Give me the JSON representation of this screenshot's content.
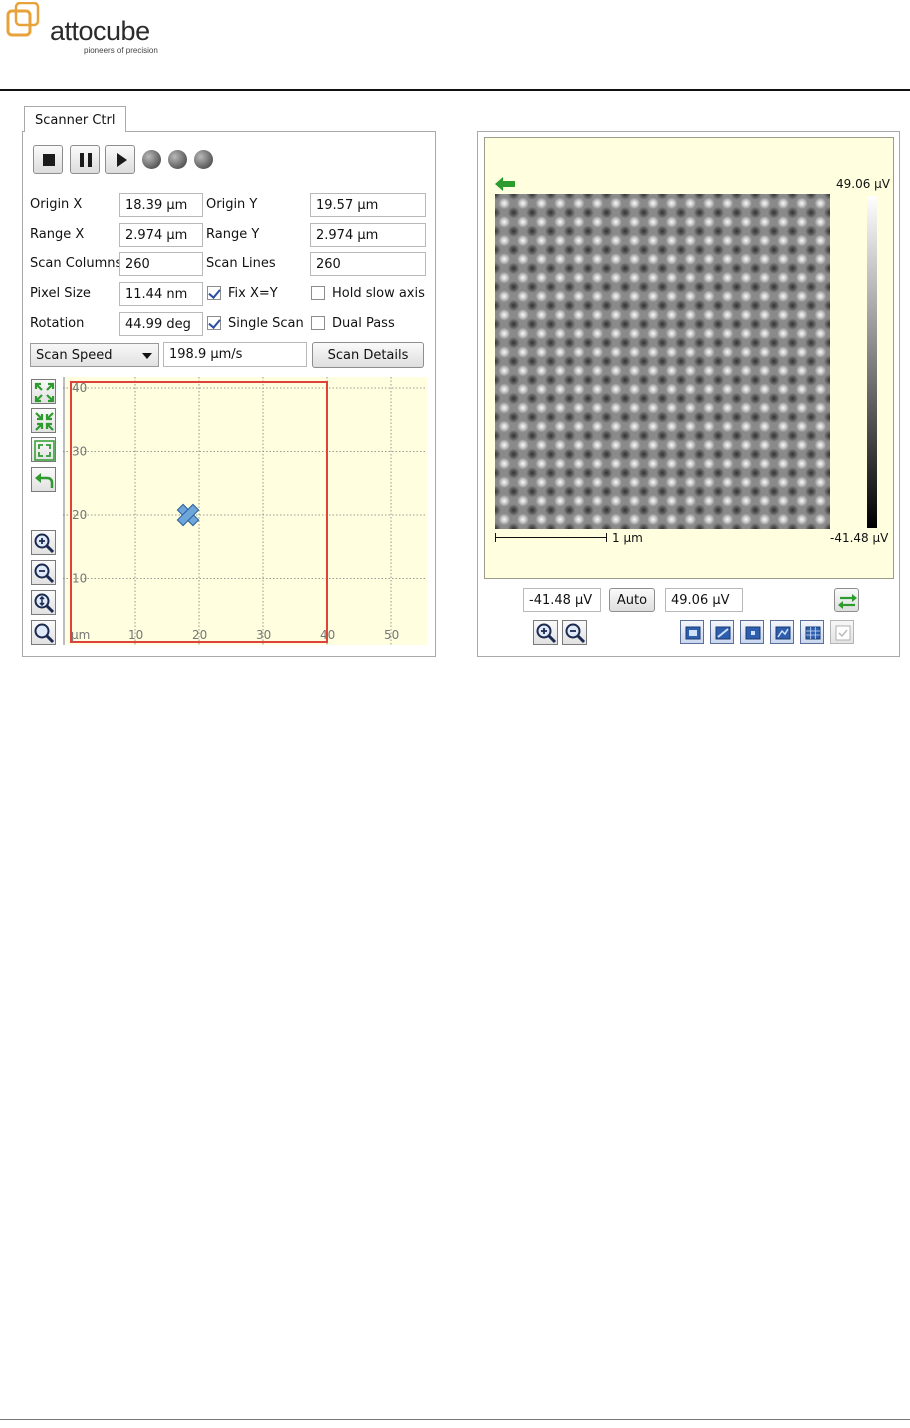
{
  "brand": {
    "name": "attocube",
    "tagline": "pioneers of precision",
    "accent_color": "#e8a23a"
  },
  "scanner_ctrl": {
    "tab_label": "Scanner Ctrl",
    "toolbar": {
      "stop_icon": "stop-icon",
      "pause_icon": "pause-icon",
      "play_icon": "play-icon",
      "status_leds": 3
    },
    "fields": {
      "origin_x": {
        "label": "Origin X",
        "value": "18.39 µm"
      },
      "origin_y": {
        "label": "Origin Y",
        "value": "19.57 µm"
      },
      "range_x": {
        "label": "Range X",
        "value": "2.974 µm"
      },
      "range_y": {
        "label": "Range Y",
        "value": "2.974 µm"
      },
      "scan_columns": {
        "label": "Scan Columns",
        "value": "260"
      },
      "scan_lines": {
        "label": "Scan Lines",
        "value": "260"
      },
      "pixel_size": {
        "label": "Pixel Size",
        "value": "11.44 nm"
      },
      "rotation": {
        "label": "Rotation",
        "value": "44.99 deg"
      }
    },
    "checkboxes": {
      "fix_xy": {
        "label": "Fix  X=Y",
        "checked": true
      },
      "hold_slow_axis": {
        "label": "Hold slow axis",
        "checked": false
      },
      "single_scan": {
        "label": "Single Scan",
        "checked": true
      },
      "dual_pass": {
        "label": "Dual Pass",
        "checked": false
      }
    },
    "speed": {
      "selected": "Scan Speed",
      "value": "198.9 µm/s",
      "details_button": "Scan Details"
    },
    "plot": {
      "unit": "µm",
      "x_ticks": [
        "10",
        "20",
        "30",
        "40",
        "50"
      ],
      "y_ticks": [
        "10",
        "20",
        "30",
        "40"
      ],
      "background": "#ffffe0",
      "frame_color": "#e0423a",
      "marker_color": "#4a86c8"
    }
  },
  "image_view": {
    "colorbar_max": "49.06 µV",
    "colorbar_min": "-41.48 µV",
    "scale_bar": "1 µm",
    "range_min_field": "-41.48 µV",
    "auto_button": "Auto",
    "range_max_field": "49.06 µV",
    "background": "#ffffe0"
  }
}
